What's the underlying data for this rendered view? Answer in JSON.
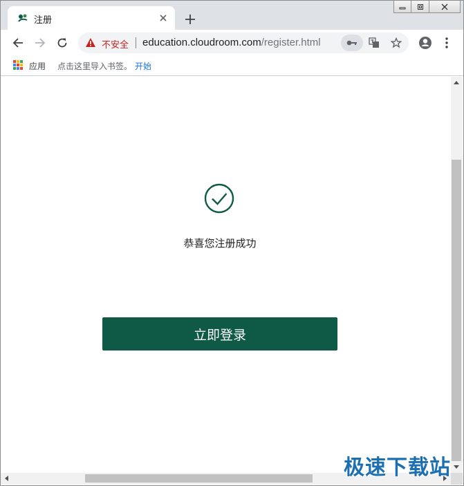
{
  "tab": {
    "title": "注册",
    "close_symbol": "✕",
    "new_tab_symbol": "+"
  },
  "window_controls": {
    "minimize_icon": "minimize-icon",
    "restore_icon": "restore-icon",
    "close_icon": "close-icon"
  },
  "toolbar": {
    "security_label": "不安全",
    "url_host": "education.cloudroom.com",
    "url_path": "/register.html"
  },
  "bookmarks": {
    "apps_label": "应用",
    "hint": "点击这里导入书签。",
    "start_link": "开始"
  },
  "main": {
    "success_message": "恭喜您注册成功",
    "login_button": "立即登录"
  },
  "watermark": "极速下载站",
  "colors": {
    "accent": "#0f5a47",
    "insecure": "#c5221f",
    "link": "#1a73e8"
  }
}
